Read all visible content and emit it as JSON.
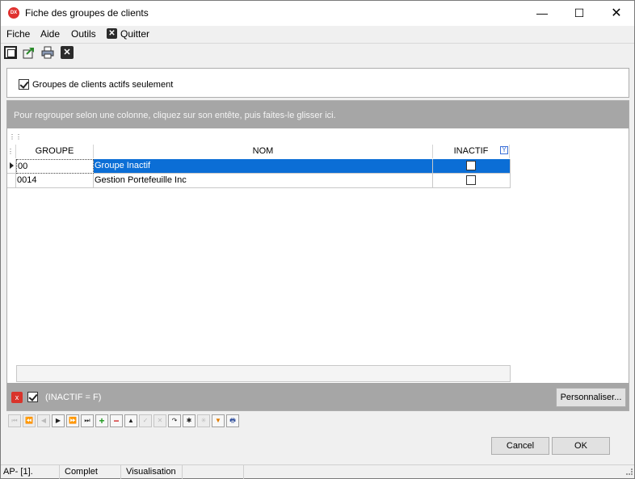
{
  "window": {
    "app_icon_text": "DX",
    "title": "Fiche des groupes de clients",
    "minimize": "—",
    "maximize": "☐",
    "close": "✕"
  },
  "menu": {
    "fiche": "Fiche",
    "aide": "Aide",
    "outils": "Outils",
    "quitter_icon": "✕",
    "quitter": "Quitter"
  },
  "toolbar": {
    "icons": [
      "select-all-icon",
      "export-icon",
      "print-icon",
      "close-icon"
    ]
  },
  "filter": {
    "actifs_checked": true,
    "actifs_label": "Groupes de clients actifs seulement"
  },
  "grid": {
    "group_panel_text": "Pour regrouper selon une colonne, cliquez sur son entête, puis faites-le glisser ici.",
    "columns": {
      "groupe": "GROUPE",
      "nom": "NOM",
      "inactif": "INACTIF"
    },
    "rows": [
      {
        "groupe": "00",
        "nom": "Groupe Inactif",
        "inactif": false,
        "selected": true
      },
      {
        "groupe": "0014",
        "nom": "Gestion Portefeuille Inc",
        "inactif": false,
        "selected": false
      }
    ],
    "filter_bar": {
      "remove_icon": "x",
      "enabled": true,
      "expression": "(INACTIF = F)",
      "customize": "Personnaliser..."
    },
    "selection_color": "#0b6ed6",
    "group_panel_color": "#a6a6a6"
  },
  "navigator": {
    "buttons": [
      "⏮",
      "⏪",
      "◀",
      "▶",
      "⏩",
      "⏭",
      "+",
      "−",
      "▲",
      "✓",
      "✕",
      "↷",
      "✱",
      "✳",
      "▼",
      "🖶"
    ]
  },
  "dialog": {
    "cancel": "Cancel",
    "ok": "OK"
  },
  "status": {
    "pane1": "AP- [1].",
    "pane2": "Complet",
    "pane3": "Visualisation",
    "pane4": ""
  }
}
